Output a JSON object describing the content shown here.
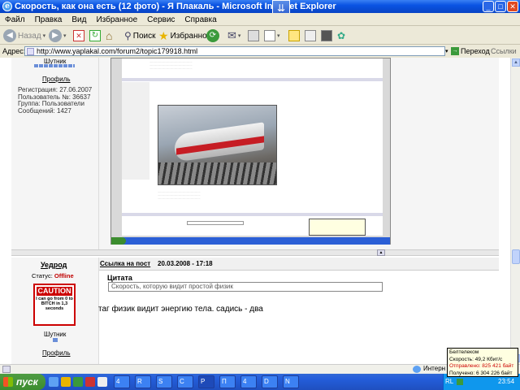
{
  "window": {
    "title": "Скорость, как она есть (12 фото) - Я Плакаль - Microsoft Internet Explorer"
  },
  "menu": [
    "Файл",
    "Правка",
    "Вид",
    "Избранное",
    "Сервис",
    "Справка"
  ],
  "toolbar": {
    "back": "Назад",
    "search": "Поиск",
    "favorites": "Избранное"
  },
  "address": {
    "label": "Адрес:",
    "url": "http://www.yaplakal.com/forum2/topic179918.html",
    "go": "Переход",
    "links": "Ссылки"
  },
  "post1": {
    "rank": "Шутник",
    "profile": "Профиль",
    "reg": "Регистрация: 27.06.2007",
    "user_no": "Пользователь №: 36637",
    "group": "Группа: Пользователи",
    "messages": "Сообщений: 1427"
  },
  "post2": {
    "user": "Уедрод",
    "status_label": "Статус:",
    "status_value": "Offline",
    "post_link": "Ссылка на пост",
    "date": "20.03.2008 - 17:18",
    "quote_label": "Цитата",
    "quote_text": "Скорость, которую видит простой физик",
    "body": "таг физик видит энергию тела. садись - два",
    "rank": "Шутник",
    "profile": "Профиль",
    "avatar_caution": "CAUTION",
    "avatar_text": "I can go from 0 to BITCH in 1,3 seconds"
  },
  "taskbar": {
    "start": "пуск",
    "items": [
      "4",
      "R",
      "S",
      "C",
      "P",
      "П",
      "4",
      "D",
      "N"
    ],
    "internet": "Интерн",
    "lang": "RL",
    "clock": "23:54"
  },
  "balloon": {
    "name": "Белтелеком",
    "speed": "Скорость: 49,2 Кбит/с",
    "sent": "Отправлено: 825 421 байт",
    "received": "Получено: 6 304 226 байт"
  },
  "colors": {
    "titlebar": "#0a54e3",
    "offline": "#c00000",
    "taskbar": "#245edb",
    "start": "#3c8d2f"
  }
}
